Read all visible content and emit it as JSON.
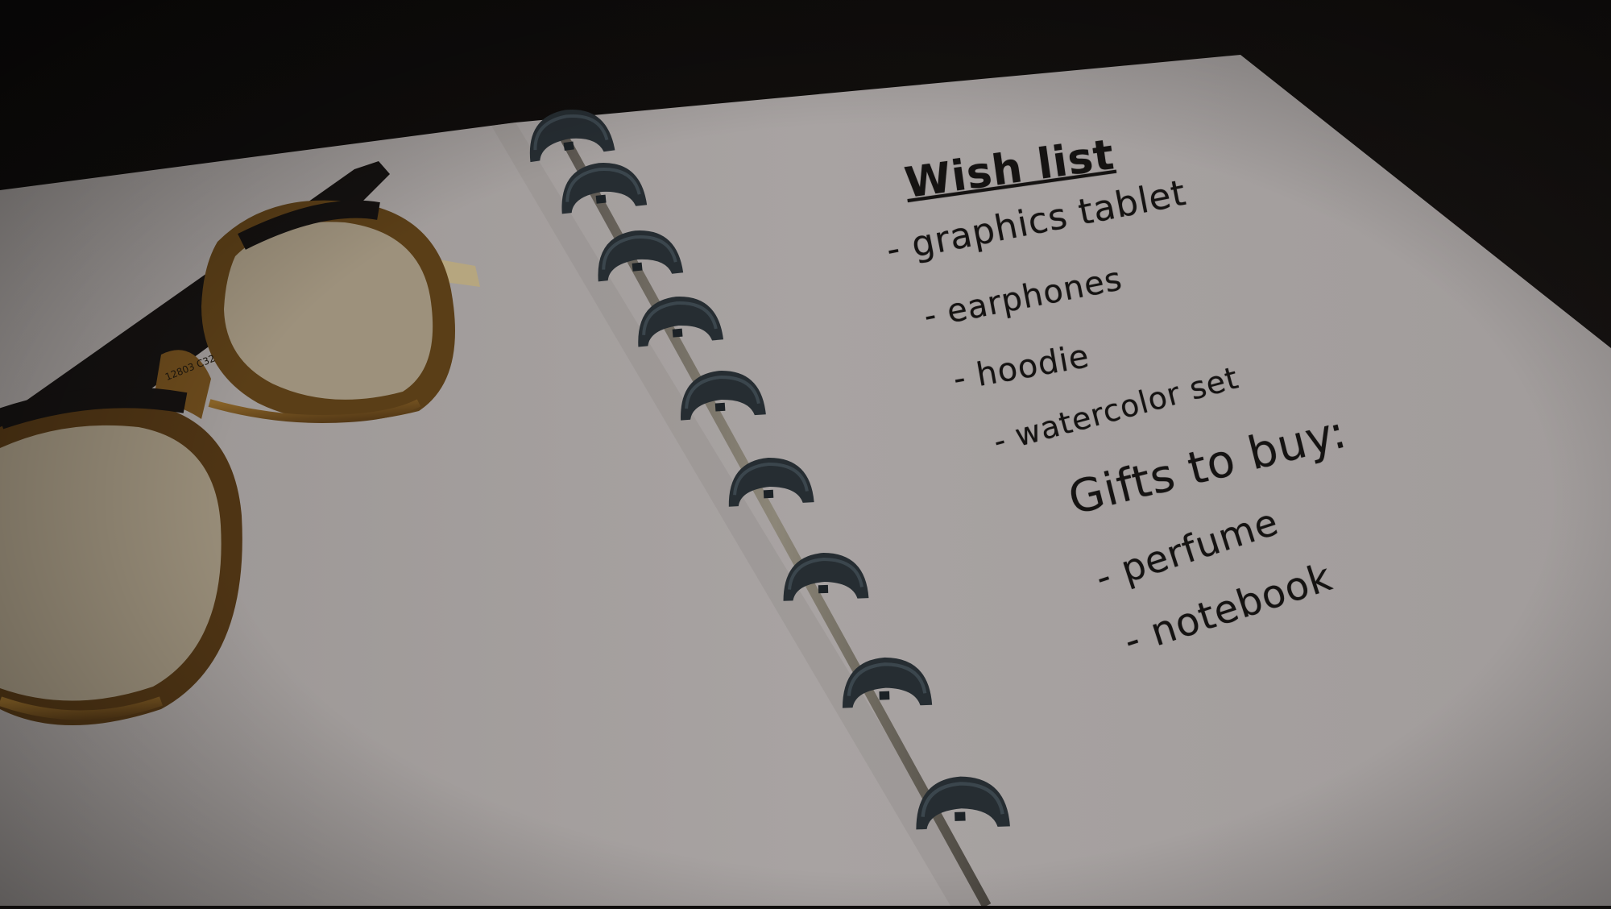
{
  "note": {
    "title": "Wish list",
    "wish_items": [
      "- graphics tablet",
      "- earphones",
      "- hoodie",
      "- watercolor set"
    ],
    "gifts_heading": "Gifts to buy:",
    "gift_items": [
      "- perfume",
      "- notebook"
    ]
  },
  "glasses": {
    "frame_marking": "12803 C32"
  },
  "colors": {
    "background": "#0f0d0c",
    "paper": "#a7a2a1",
    "ink": "#151312",
    "binder_disc": "#262d32",
    "frame_dark": "#141110",
    "frame_amber": "#6b4a1c",
    "temple_arm": "#b8a77c"
  },
  "icons": [
    "binder-ring-icon",
    "eyeglasses-icon"
  ]
}
